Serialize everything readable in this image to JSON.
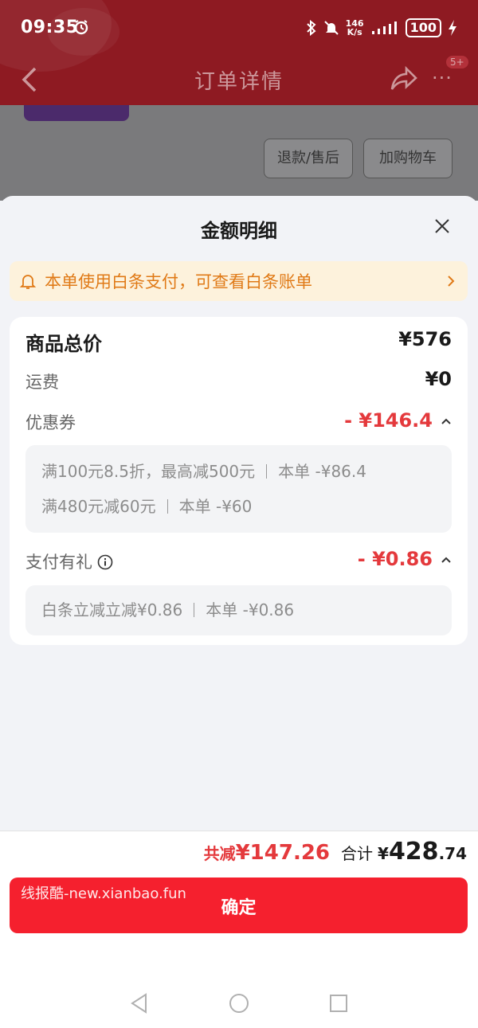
{
  "status_bar": {
    "time": "09:35",
    "net_speed_value": "146",
    "net_speed_unit": "K/s",
    "battery": "100"
  },
  "header": {
    "title": "订单详情",
    "badge": "5+",
    "more": "···"
  },
  "background": {
    "refund_label": "退款/售后",
    "cart_label": "加购物车"
  },
  "sheet": {
    "title": "金额明细"
  },
  "notice": {
    "text": "本单使用白条支付，可查看白条账单"
  },
  "summary": {
    "goods": {
      "label": "商品总价",
      "value": "¥576"
    },
    "shipping": {
      "label": "运费",
      "value": "¥0"
    },
    "coupon": {
      "label": "优惠券",
      "value": "- ¥146.4",
      "details": [
        {
          "rule": "满100元8.5折，最高减500元",
          "amount": "本单 -¥86.4"
        },
        {
          "rule": "满480元减60元",
          "amount": "本单 -¥60"
        }
      ]
    },
    "pay_gift": {
      "label": "支付有礼",
      "value": "- ¥0.86",
      "details": [
        {
          "rule": "白条立减立减¥0.86",
          "amount": "本单 -¥0.86"
        }
      ]
    }
  },
  "footer": {
    "saved_label": "共减",
    "saved_value": "¥147.26",
    "total_label": "合计",
    "total_currency": "¥",
    "total_integer": "428",
    "total_decimal": ".74",
    "confirm_label": "确定",
    "watermark": "线报酷-new.xianbao.fun"
  },
  "colors": {
    "accent_red": "#e4393c",
    "button_red": "#f5202e",
    "notice_orange": "#e07a17",
    "notice_bg": "#fdf2dc"
  }
}
